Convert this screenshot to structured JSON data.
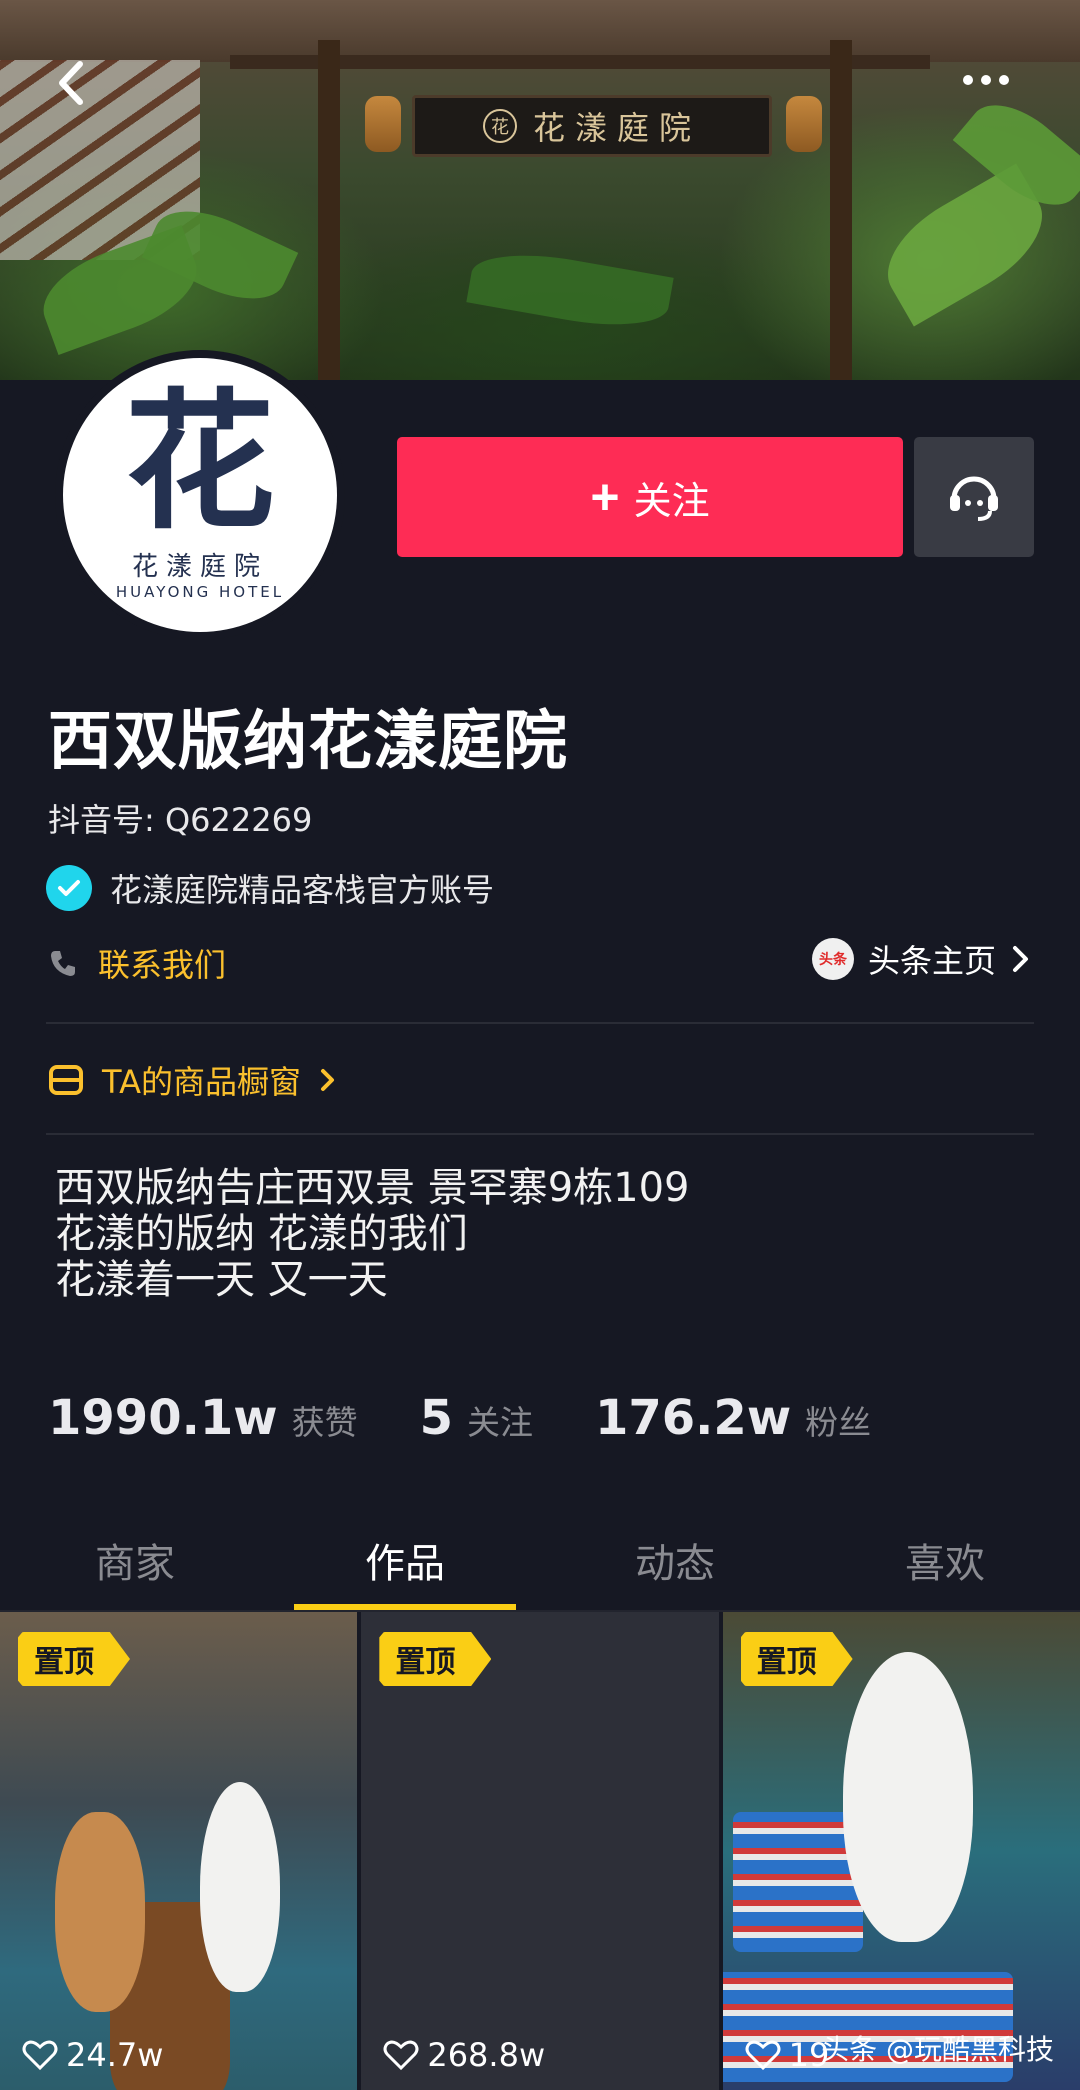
{
  "cover": {
    "sign_text": "花漾庭院",
    "sign_logo": "花"
  },
  "nav": {
    "back_icon": "back-arrow-icon",
    "more_icon": "more-dots-icon"
  },
  "avatar": {
    "logo_char": "花",
    "logo_name": "花漾庭院",
    "logo_sub": "HUAYONG HOTEL"
  },
  "actions": {
    "follow_plus": "+",
    "follow_label": "关注",
    "service_icon": "headset-icon"
  },
  "profile": {
    "name": "西双版纳花漾庭院",
    "douyin_id": "抖音号: Q622269",
    "verified_label": "花漾庭院精品客栈官方账号",
    "contact_label": "联系我们",
    "toutiao_logo": "头条",
    "toutiao_label": "头条主页",
    "shop_label": "TA的商品橱窗"
  },
  "bio": [
    "西双版纳告庄西双景 景罕寨9栋109",
    "花漾的版纳 花漾的我们",
    "花漾着一天 又一天"
  ],
  "stats": [
    {
      "value": "1990.1w",
      "label": "获赞"
    },
    {
      "value": "5",
      "label": "关注"
    },
    {
      "value": "176.2w",
      "label": "粉丝"
    }
  ],
  "tabs": [
    {
      "label": "商家",
      "active": false
    },
    {
      "label": "作品",
      "active": true
    },
    {
      "label": "动态",
      "active": false
    },
    {
      "label": "喜欢",
      "active": false
    }
  ],
  "videos": [
    {
      "badge": "置顶",
      "likes": "24.7w"
    },
    {
      "badge": "置顶",
      "likes": "268.8w"
    },
    {
      "badge": "置顶",
      "likes": "19"
    }
  ],
  "watermark": "头条 @玩酷黑科技",
  "colors": {
    "accent": "#fe2c55",
    "yellow": "#face15",
    "gold_text": "#fbc02d",
    "background": "#161823",
    "verify": "#20d5ec"
  }
}
